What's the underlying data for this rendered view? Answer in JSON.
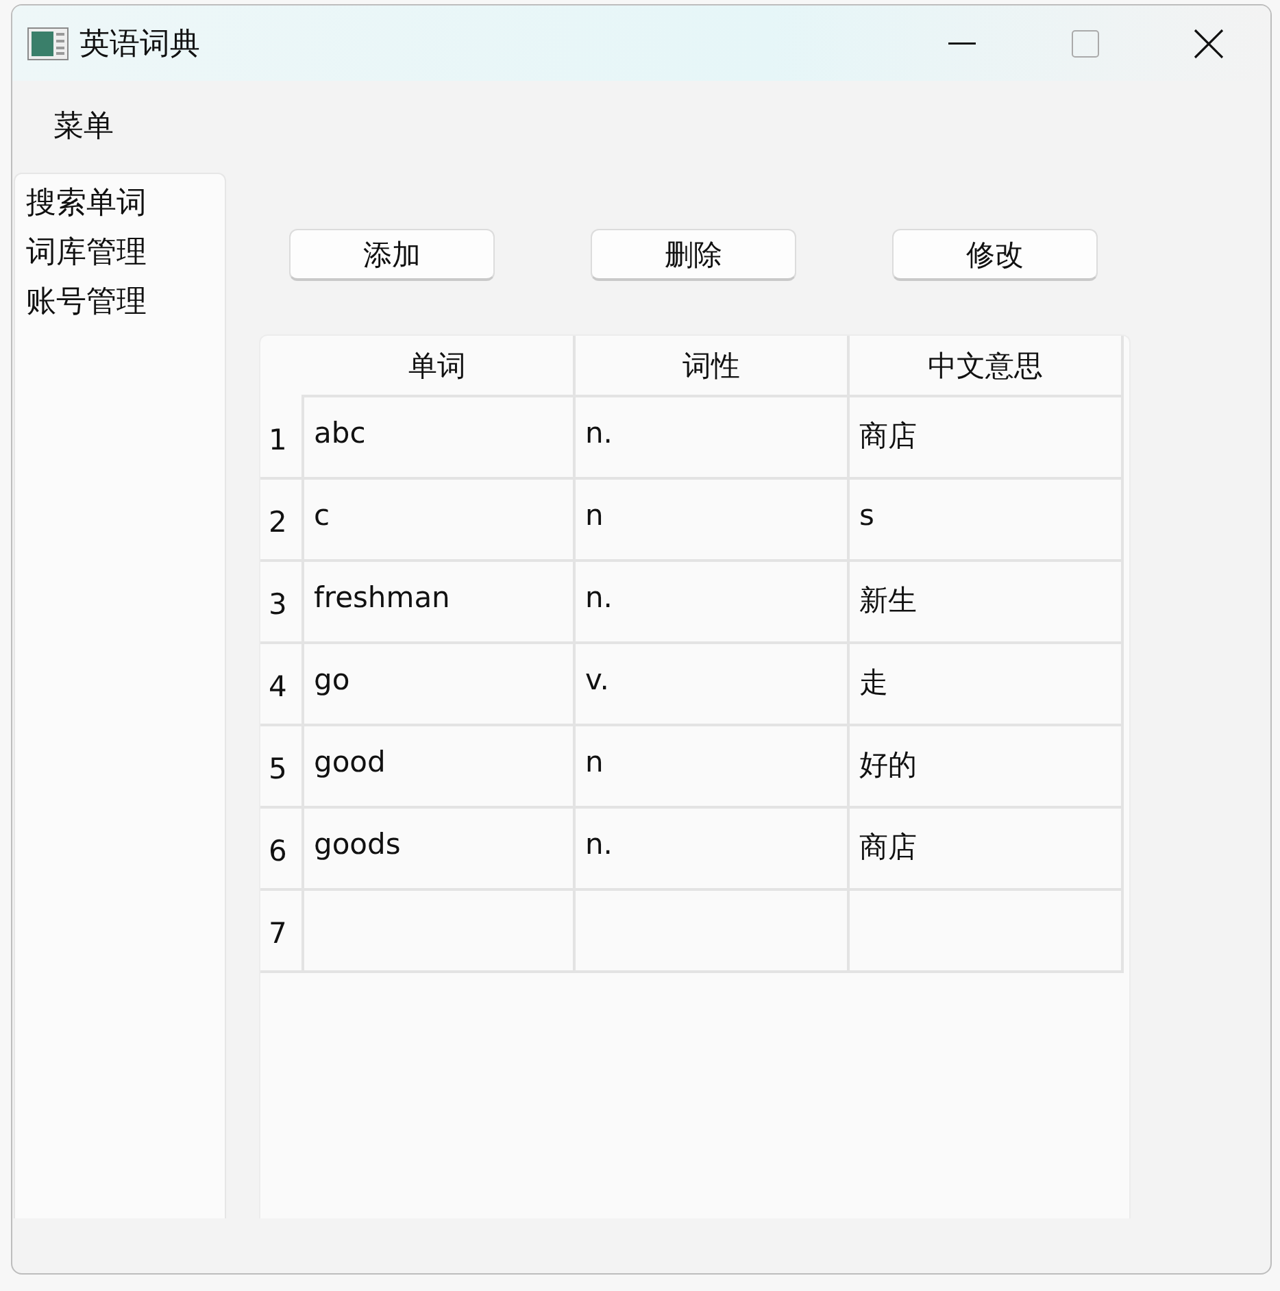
{
  "window": {
    "title": "英语词典"
  },
  "menu": {
    "label": "菜单"
  },
  "sidebar": {
    "items": [
      {
        "label": "搜索单词"
      },
      {
        "label": "词库管理"
      },
      {
        "label": "账号管理"
      }
    ]
  },
  "buttons": [
    "添加",
    "删除",
    "修改"
  ],
  "table": {
    "columns": [
      "单词",
      "词性",
      "中文意思"
    ],
    "rows": [
      {
        "number": "1",
        "cells": [
          "abc",
          "n.",
          "商店"
        ]
      },
      {
        "number": "2",
        "cells": [
          "c",
          "n",
          "s"
        ]
      },
      {
        "number": "3",
        "cells": [
          "freshman",
          "n.",
          "新生"
        ]
      },
      {
        "number": "4",
        "cells": [
          "go",
          "v.",
          "走"
        ]
      },
      {
        "number": "5",
        "cells": [
          "good",
          "n",
          "好的"
        ]
      },
      {
        "number": "6",
        "cells": [
          "goods",
          "n.",
          "商店"
        ]
      },
      {
        "number": "7"
      }
    ]
  }
}
